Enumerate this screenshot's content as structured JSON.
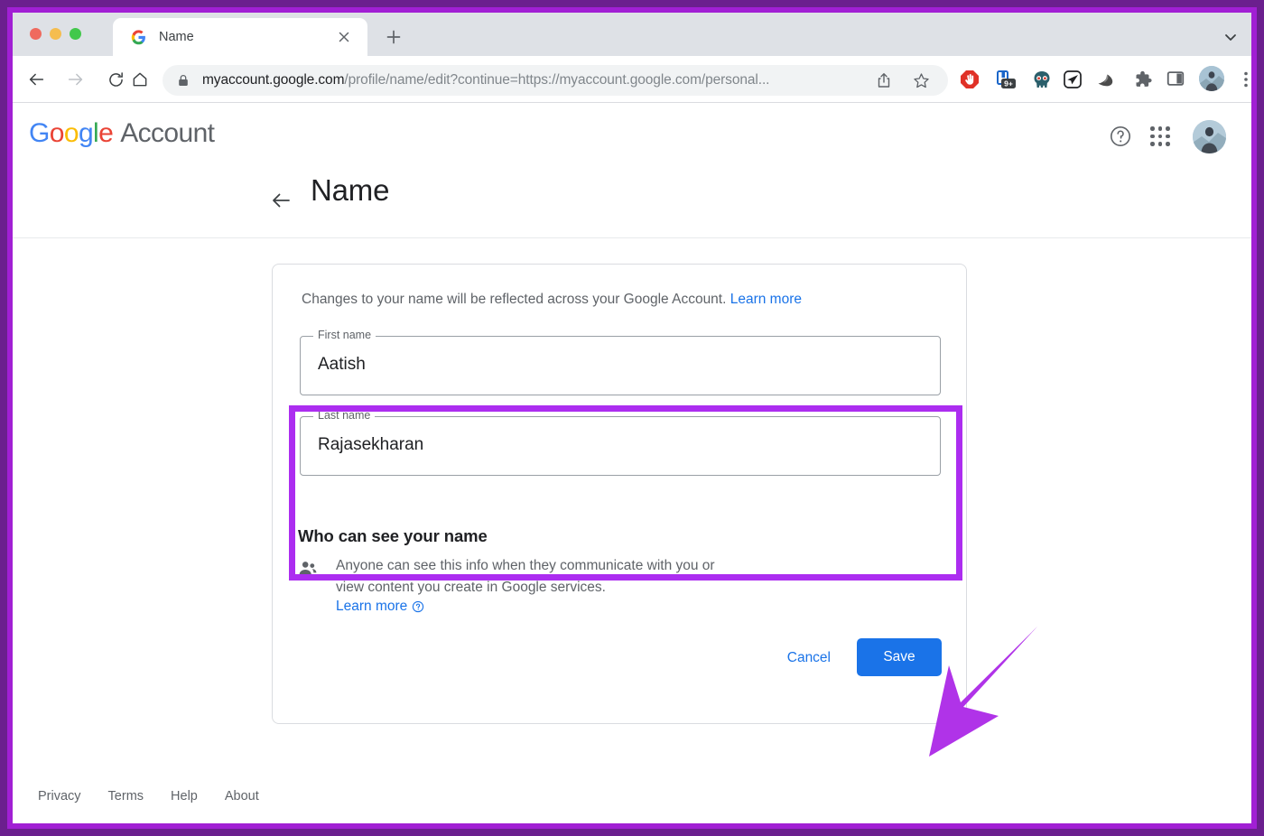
{
  "browser": {
    "tab": {
      "title": "Name",
      "favicon": "google-g-icon",
      "close_icon": "close-icon"
    },
    "new_tab_icon": "plus-icon",
    "tabstrip_chevron_icon": "chevron-down-icon",
    "nav": {
      "back_icon": "arrow-left-icon",
      "forward_icon": "arrow-right-icon",
      "reload_icon": "reload-icon",
      "home_icon": "home-icon"
    },
    "omnibox": {
      "lock_icon": "lock-icon",
      "url_bold": "myaccount.google.com",
      "url_rest": "/profile/name/edit?continue=https://myaccount.google.com/personal...",
      "url_full": "myaccount.google.com/profile/name/edit?continue=https://myaccount.google.com/personal...",
      "share_icon": "share-icon",
      "bookmark_icon": "star-icon"
    },
    "extensions": [
      {
        "name": "adblock-icon",
        "label": "AdBlock"
      },
      {
        "name": "extension-badge-icon",
        "label": "9+"
      },
      {
        "name": "skull-mask-icon",
        "label": ""
      },
      {
        "name": "paper-plane-icon",
        "label": ""
      },
      {
        "name": "swoosh-icon",
        "label": ""
      },
      {
        "name": "puzzle-icon",
        "label": "Extensions"
      },
      {
        "name": "side-panel-icon",
        "label": "Side panel"
      }
    ],
    "profile_avatar": "avatar",
    "menu_icon": "three-dot-menu-icon"
  },
  "app": {
    "logo": {
      "g1": "G",
      "o1": "o",
      "o2": "o",
      "g2": "g",
      "l": "l",
      "e": "e",
      "suffix": "Account"
    },
    "help_icon": "help-circle-icon",
    "apps_icon": "apps-grid-icon",
    "avatar": "avatar"
  },
  "page": {
    "back_icon": "arrow-left-icon",
    "title": "Name"
  },
  "card": {
    "intro_text": "Changes to your name will be reflected across your Google Account.",
    "intro_link": "Learn more",
    "fields": [
      {
        "label": "First name",
        "value": "Aatish",
        "placeholder": "First name"
      },
      {
        "label": "Last name",
        "value": "Rajasekharan",
        "placeholder": "Last name"
      }
    ],
    "visibility": {
      "title": "Who can see your name",
      "icon": "people-icon",
      "description": "Anyone can see this info when they communicate with you or view content you create in Google services.",
      "link": "Learn more",
      "link_icon": "help-circle-icon"
    },
    "actions": {
      "cancel_label": "Cancel",
      "save_label": "Save"
    }
  },
  "footer": {
    "links": [
      "Privacy",
      "Terms",
      "Help",
      "About"
    ]
  },
  "annotations": {
    "highlight_color": "#ac2df0",
    "frame_color": "#a11fd4",
    "arrow_color": "#b033e8",
    "accent_color": "#1a73e8"
  }
}
